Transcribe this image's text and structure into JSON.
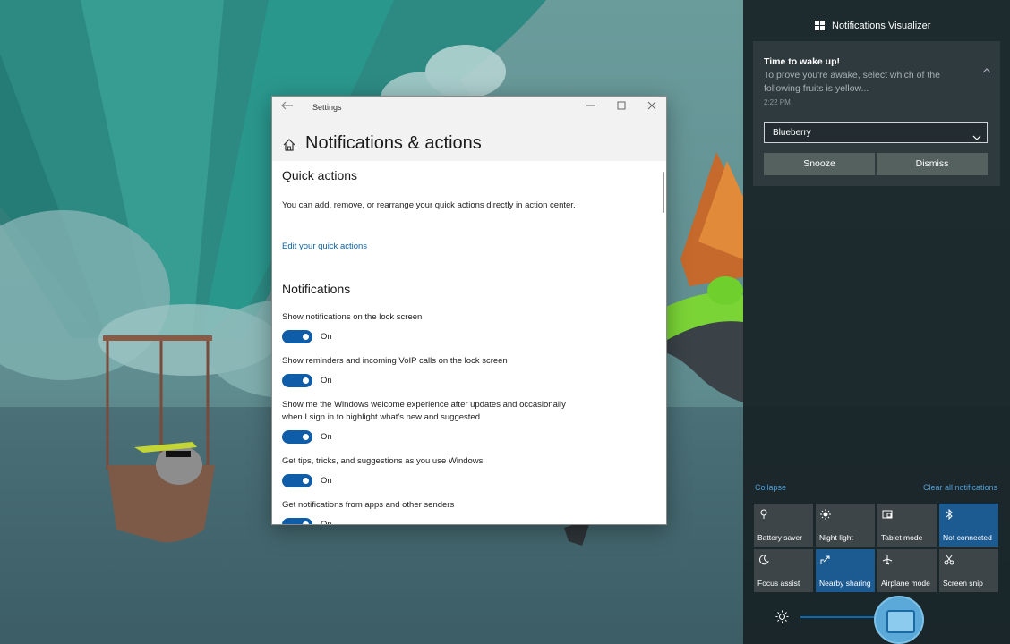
{
  "settings_window": {
    "title": "Settings",
    "back_icon": "back-arrow-icon",
    "minimize_icon": "minimize-icon",
    "maximize_icon": "maximize-icon",
    "close_icon": "close-icon",
    "page_title": "Notifications & actions",
    "home_icon": "home-icon",
    "quick_actions": {
      "title": "Quick actions",
      "description": "You can add, remove, or rearrange your quick actions directly in action center.",
      "link": "Edit your quick actions"
    },
    "notifications": {
      "title": "Notifications",
      "settings": [
        {
          "label": "Show notifications on the lock screen",
          "state": "On"
        },
        {
          "label": "Show reminders and incoming VoIP calls on the lock screen",
          "state": "On"
        },
        {
          "label": "Show me the Windows welcome experience after updates and occasionally when I sign in to highlight what's new and suggested",
          "state": "On"
        },
        {
          "label": "Get tips, tricks, and suggestions as you use Windows",
          "state": "On"
        },
        {
          "label": "Get notifications from apps and other senders",
          "state": "On"
        }
      ]
    }
  },
  "action_center": {
    "app_name": "Notifications Visualizer",
    "app_icon": "windows-tiles-icon",
    "toast": {
      "title": "Time to wake up!",
      "body": "To prove you're awake, select which of the following fruits is yellow...",
      "time": "2:22 PM",
      "selected_option": "Blueberry",
      "snooze_label": "Snooze",
      "dismiss_label": "Dismiss"
    },
    "collapse_label": "Collapse",
    "clear_all_label": "Clear all notifications",
    "quick_actions": [
      {
        "label": "Battery saver",
        "icon": "battery-saver-icon",
        "active": false
      },
      {
        "label": "Night light",
        "icon": "night-light-icon",
        "active": false
      },
      {
        "label": "Tablet mode",
        "icon": "tablet-mode-icon",
        "active": false
      },
      {
        "label": "Not connected",
        "icon": "bluetooth-icon",
        "active": true
      },
      {
        "label": "Focus assist",
        "icon": "focus-assist-icon",
        "active": false
      },
      {
        "label": "Nearby sharing",
        "icon": "nearby-sharing-icon",
        "active": true
      },
      {
        "label": "Airplane mode",
        "icon": "airplane-icon",
        "active": false
      },
      {
        "label": "Screen snip",
        "icon": "screen-snip-icon",
        "active": false
      }
    ],
    "brightness_icon": "brightness-icon",
    "brightness_level": 0.62
  },
  "colors": {
    "accent": "#0f5da8",
    "active_tile": "#1c5a92",
    "inactive_tile": "#3d4549",
    "link": "#0b5f9e"
  }
}
